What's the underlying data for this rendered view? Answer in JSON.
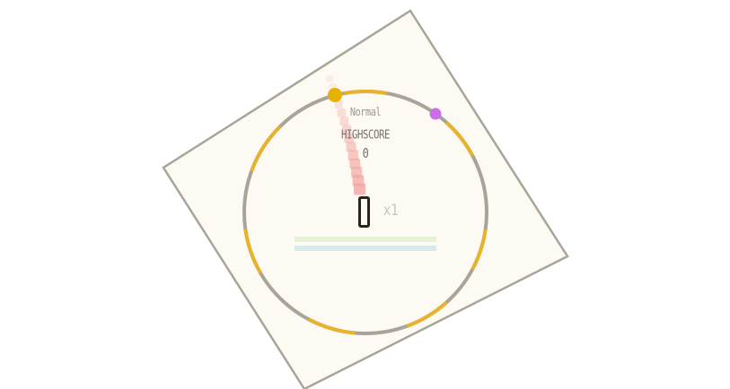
{
  "hud": {
    "mode": "Normal",
    "highscore_label": "HIGHSCORE",
    "highscore_value": "0",
    "score": "0",
    "multiplier": "x1"
  },
  "colors": {
    "background": "#ffffff",
    "board_fill": "#fdf9f3",
    "board_stroke": "#a8a598",
    "ring": "#a8a598",
    "ring_segment": "#e8b32a",
    "player": "#e8b000",
    "target": "#c96ee8",
    "trail": "#f2a7a2",
    "meter_green": "#e6f2d6",
    "meter_blue": "#d6ecec"
  },
  "icons": {
    "player": "player-dot-icon",
    "target": "target-dot-icon"
  }
}
